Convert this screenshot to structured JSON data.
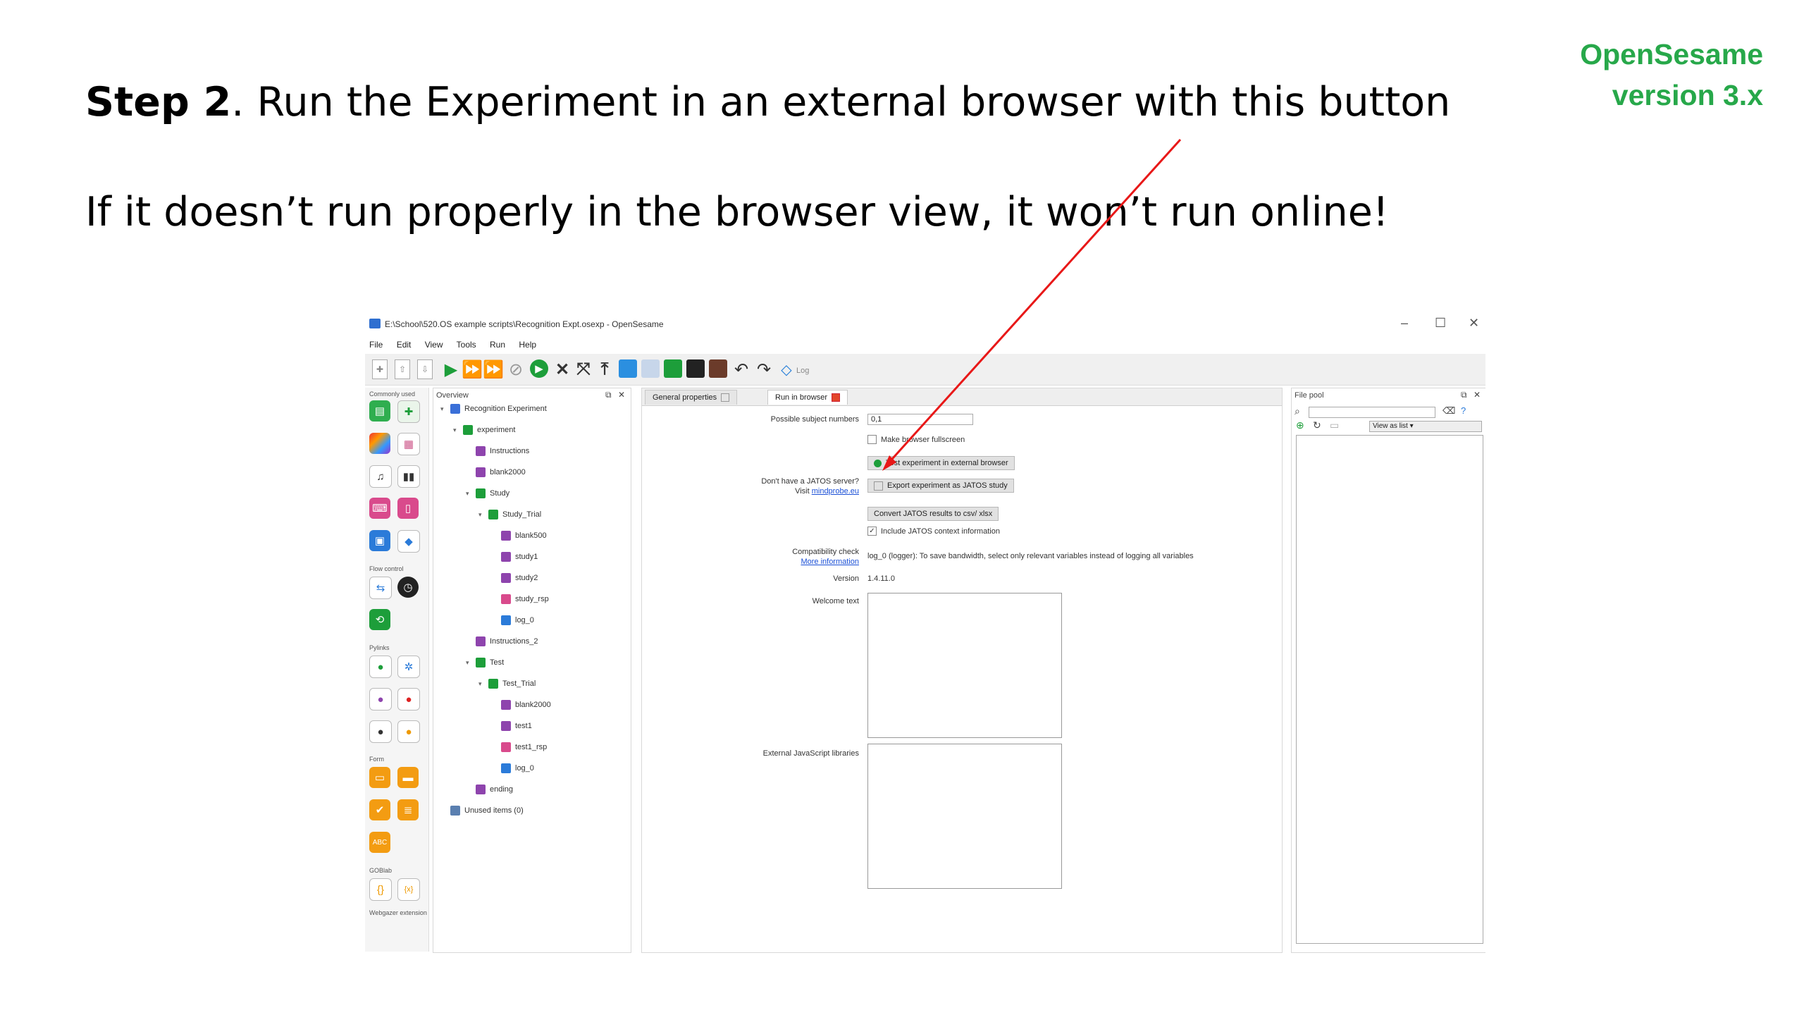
{
  "slide": {
    "badge_line1": "OpenSesame",
    "badge_line2": "version 3.x",
    "step_label": "Step 2",
    "step_text": ". Run the Experiment in an external browser with this button",
    "note": "If it doesn’t run properly in the browser view, it won’t run online!"
  },
  "window": {
    "title": "E:\\School\\520.OS example scripts\\Recognition Expt.osexp - OpenSesame",
    "minimize": "–",
    "maximize": "☐",
    "close": "✕"
  },
  "menubar": [
    "File",
    "Edit",
    "View",
    "Tools",
    "Run",
    "Help"
  ],
  "toolbar": {
    "log_label": "Log"
  },
  "itembar": {
    "header": "Commonly used",
    "categories": [
      "Flow control",
      "Pylinks",
      "Form",
      "GOBlab",
      "Webgazer extension"
    ]
  },
  "overview": {
    "header": "Overview",
    "items": [
      {
        "label": "Recognition Experiment",
        "level": 0,
        "color": "#3a6fd8"
      },
      {
        "label": "experiment",
        "level": 1,
        "color": "#1d9e3a"
      },
      {
        "label": "Instructions",
        "level": 2,
        "color": "#8e44ad"
      },
      {
        "label": "blank2000",
        "level": 2,
        "color": "#8e44ad"
      },
      {
        "label": "Study",
        "level": 2,
        "color": "#1d9e3a"
      },
      {
        "label": "Study_Trial",
        "level": 3,
        "color": "#1d9e3a"
      },
      {
        "label": "blank500",
        "level": 4,
        "color": "#8e44ad"
      },
      {
        "label": "study1",
        "level": 4,
        "color": "#8e44ad"
      },
      {
        "label": "study2",
        "level": 4,
        "color": "#8e44ad"
      },
      {
        "label": "study_rsp",
        "level": 4,
        "color": "#d94a8c"
      },
      {
        "label": "log_0",
        "level": 4,
        "color": "#2b7bd9"
      },
      {
        "label": "Instructions_2",
        "level": 2,
        "color": "#8e44ad"
      },
      {
        "label": "Test",
        "level": 2,
        "color": "#1d9e3a"
      },
      {
        "label": "Test_Trial",
        "level": 3,
        "color": "#1d9e3a"
      },
      {
        "label": "blank2000",
        "level": 4,
        "color": "#8e44ad"
      },
      {
        "label": "test1",
        "level": 4,
        "color": "#8e44ad"
      },
      {
        "label": "test1_rsp",
        "level": 4,
        "color": "#d94a8c"
      },
      {
        "label": "log_0",
        "level": 4,
        "color": "#2b7bd9"
      },
      {
        "label": "ending",
        "level": 2,
        "color": "#8e44ad"
      },
      {
        "label": "Unused items (0)",
        "level": 0,
        "color": "#5a7fb0"
      }
    ]
  },
  "tabs": [
    {
      "label": "General properties",
      "active": false
    },
    {
      "label": "Run in browser",
      "active": true
    }
  ],
  "run_in_browser": {
    "subject_numbers_label": "Possible subject numbers",
    "subject_numbers_value": "0,1",
    "fullscreen_label": "Make browser fullscreen",
    "test_button": "Test experiment in external browser",
    "jatos_label": "Don't have a JATOS server?",
    "visit_label": "Visit",
    "visit_link": "mindprobe.eu",
    "export_button": "Export experiment as JATOS study",
    "convert_button": "Convert JATOS results to csv/ xlsx",
    "include_label": "Include JATOS context information",
    "compat_label": "Compatibility check",
    "more_info_link": "More information",
    "compat_msg": "log_0 (logger): To save bandwidth, select only relevant variables instead of logging all variables",
    "version_label": "Version",
    "version_value": "1.4.11.0",
    "welcome_label": "Welcome text",
    "external_js_label": "External JavaScript libraries"
  },
  "filepool": {
    "header": "File pool",
    "view_as": "View as list"
  },
  "colors": {
    "badge": "#27a84a",
    "annotation_arrow": "#e81818",
    "run_green": "#1d9e3a"
  }
}
